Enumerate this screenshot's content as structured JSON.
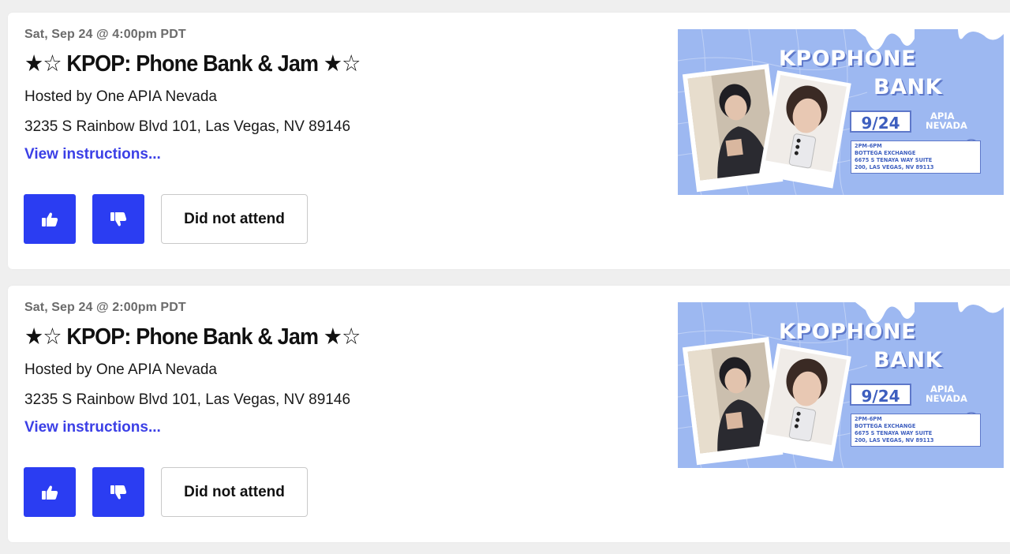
{
  "events": [
    {
      "date": "Sat, Sep 24 @ 4:00pm PDT",
      "title": "★☆ KPOP: Phone Bank & Jam ★☆",
      "host": "Hosted by One APIA Nevada",
      "address": "3235 S Rainbow Blvd 101, Las Vegas, NV 89146",
      "instructions_link": "View instructions...",
      "thumbs_up_icon": "thumbs-up-icon",
      "thumbs_down_icon": "thumbs-down-icon",
      "did_not_attend_label": "Did not attend",
      "image": {
        "line1": "KPOPHONE",
        "line2": "BANK",
        "date": "9/24",
        "org_line1": "APIA",
        "org_line2": "NEVADA",
        "info": [
          "2PM-6PM",
          "BOTTEGA EXCHANGE",
          "6675 S TENAYA WAY SUITE",
          "200, LAS VEGAS, NV 89113"
        ]
      }
    },
    {
      "date": "Sat, Sep 24 @ 2:00pm PDT",
      "title": "★☆ KPOP: Phone Bank & Jam ★☆",
      "host": "Hosted by One APIA Nevada",
      "address": "3235 S Rainbow Blvd 101, Las Vegas, NV 89146",
      "instructions_link": "View instructions...",
      "thumbs_up_icon": "thumbs-up-icon",
      "thumbs_down_icon": "thumbs-down-icon",
      "did_not_attend_label": "Did not attend",
      "image": {
        "line1": "KPOPHONE",
        "line2": "BANK",
        "date": "9/24",
        "org_line1": "APIA",
        "org_line2": "NEVADA",
        "info": [
          "2PM-6PM",
          "BOTTEGA EXCHANGE",
          "6675 S TENAYA WAY SUITE",
          "200, LAS VEGAS, NV 89113"
        ]
      }
    }
  ],
  "colors": {
    "accent": "#2b3df2",
    "link": "#3b3fe6",
    "image_bg": "#9db8f1"
  }
}
